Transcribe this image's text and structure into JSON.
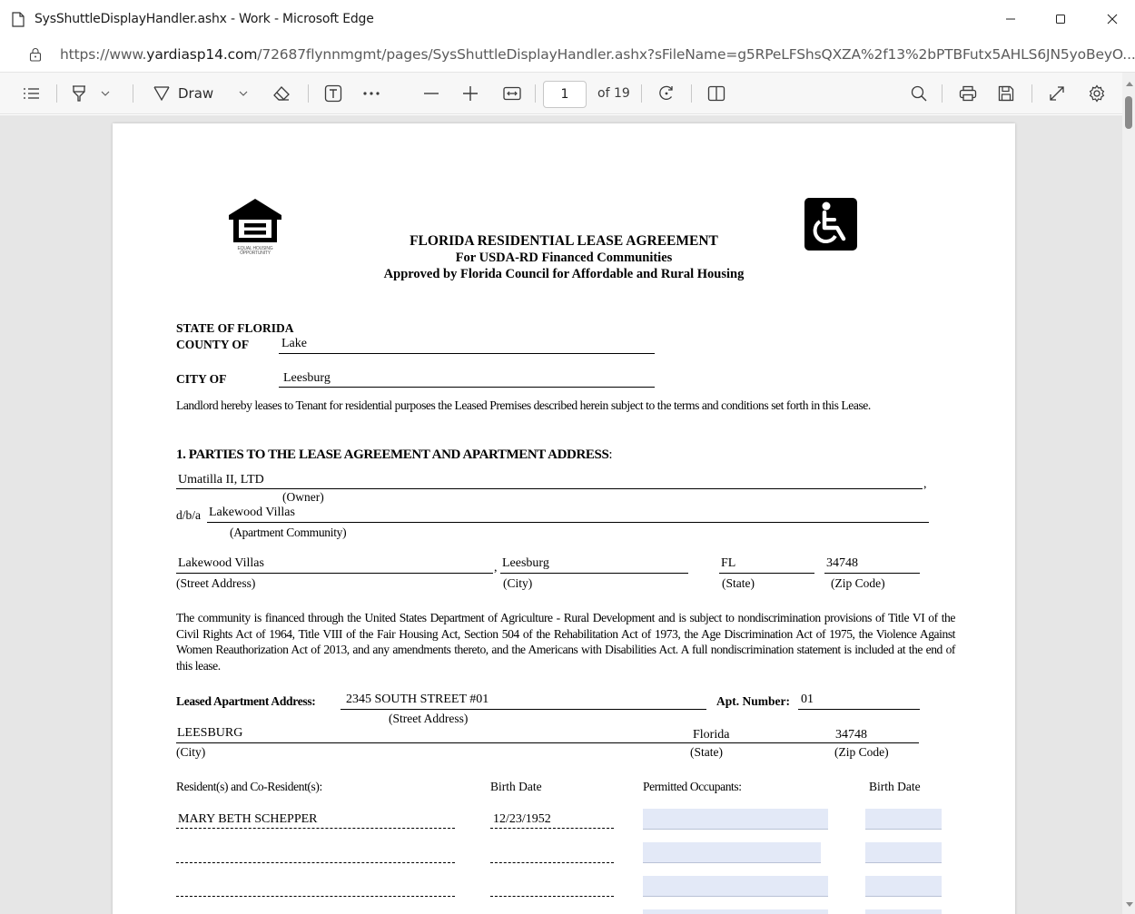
{
  "window": {
    "title": "SysShuttleDisplayHandler.ashx - Work - Microsoft Edge",
    "url_prefix": "https://www.",
    "url_host": "yardiasp14.com",
    "url_path": "/72687flynnmgmt/pages/SysShuttleDisplayHandler.ashx?sFileName=g5RPeLFShsQXZA%2f13%2bPTBFutx5AHLS6JN5yoBeyO..."
  },
  "toolbar": {
    "draw_label": "Draw",
    "page_number": "1",
    "page_total": "of 19"
  },
  "document": {
    "logo_caption": "EQUAL HOUSING OPPORTUNITY",
    "heading": "FLORIDA RESIDENTIAL LEASE AGREEMENT",
    "subheading": "For USDA-RD Financed Communities",
    "approved_by": "Approved by Florida Council for Affordable and Rural Housing",
    "state_label": "STATE OF FLORIDA",
    "county_label": "COUNTY OF",
    "county_value": "Lake",
    "city_label": "CITY OF",
    "city_value": "Leesburg",
    "intro": "Landlord hereby leases to Tenant for residential purposes the Leased Premises described herein subject to the terms and conditions set forth in this Lease.",
    "section1_heading": "1.  PARTIES TO THE LEASE AGREEMENT AND APARTMENT ADDRESS",
    "section1_colon": ":",
    "owner_value": "Umatilla II, LTD",
    "owner_comma": ",",
    "owner_caption": "(Owner)",
    "dba_label": "d/b/a",
    "community_value": "Lakewood Villas",
    "community_caption": "(Apartment Community)",
    "street_value": "Lakewood Villas",
    "street_caption": "(Street Address)",
    "comma": ",",
    "city2_value": "Leesburg",
    "city_caption": "(City)",
    "state_value": "FL",
    "state_caption": "(State)",
    "zip_value": "34748",
    "zip_caption": "(Zip Code)",
    "nondiscrimination": "The community is financed through the United States Department of Agriculture - Rural Development and is subject to nondiscrimination provisions of Title VI of the Civil Rights Act of 1964, Title VIII of the Fair Housing Act, Section 504 of the Rehabilitation Act of 1973, the Age Discrimination Act of 1975, the Violence Against Women Reauthorization Act of 2013, and any amendments thereto, and the Americans with Disabilities Act.  A full nondiscrimination statement is included at the end of this lease.",
    "leased_address_label": "Leased Apartment Address:",
    "leased_address_value": "2345 SOUTH STREET #01",
    "apt_number_label": "Apt. Number:",
    "apt_number_value": "01",
    "leased_street_caption": "(Street Address)",
    "leased_city_value": "LEESBURG",
    "leased_city_caption": "(City)",
    "leased_state_value": "Florida",
    "leased_state_caption": "(State)",
    "leased_zip_value": "34748",
    "leased_zip_caption": "(Zip Code)",
    "residents_header": "Resident(s) and Co-Resident(s):",
    "birth_date_header": "Birth Date",
    "occupants_header": "Permitted Occupants:",
    "birth_date_header2": "Birth Date",
    "resident_1_name": "MARY BETH SCHEPPER",
    "resident_1_birth": "12/23/1952"
  }
}
